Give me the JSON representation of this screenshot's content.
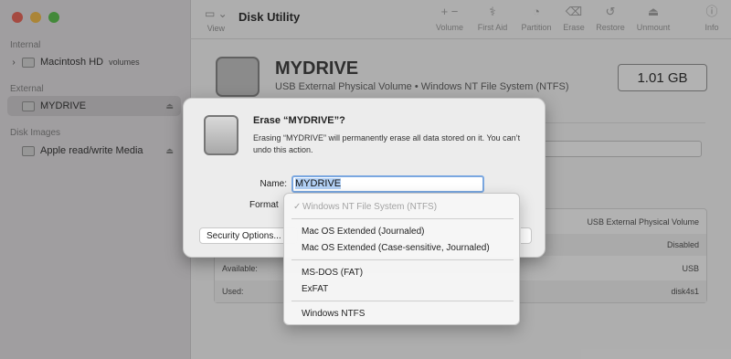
{
  "app": {
    "title": "Disk Utility"
  },
  "sidebar": {
    "sections": {
      "internal": "Internal",
      "external": "External",
      "disk_images": "Disk Images"
    },
    "items": [
      {
        "label": "Macintosh HD",
        "sub": "volumes"
      },
      {
        "label": "MYDRIVE"
      },
      {
        "label": "Apple read/write Media"
      }
    ]
  },
  "toolbar": {
    "view": "View",
    "volume": "Volume",
    "first_aid": "First Aid",
    "partition": "Partition",
    "erase": "Erase",
    "restore": "Restore",
    "unmount": "Unmount",
    "info": "Info",
    "volume_icon": "+ −"
  },
  "main": {
    "disk_name": "MYDRIVE",
    "disk_desc": "USB External Physical Volume • Windows NT File System (NTFS)",
    "size": "1.01 GB",
    "info_rows": [
      {
        "key": "",
        "value": "USB External Physical Volume"
      },
      {
        "key": "",
        "value": "Disabled"
      },
      {
        "key": "Available:",
        "value": "USB"
      },
      {
        "key": "Used:",
        "value": "disk4s1"
      }
    ]
  },
  "dialog": {
    "title": "Erase “MYDRIVE”?",
    "message": "Erasing “MYDRIVE” will permanently erase all data stored on it. You can’t undo this action.",
    "name_label": "Name:",
    "name_value": "MYDRIVE",
    "format_label": "Format",
    "security_button": "Security Options..."
  },
  "format_menu": {
    "selected": "Windows NT File System (NTFS)",
    "groups": [
      [
        "Mac OS Extended (Journaled)",
        "Mac OS Extended (Case-sensitive, Journaled)"
      ],
      [
        "MS-DOS (FAT)",
        "ExFAT"
      ],
      [
        "Windows NTFS"
      ]
    ]
  },
  "colors": {
    "close": "#ed6a5e",
    "minimize": "#f5bf4f",
    "zoom": "#61c554",
    "selection": "#b3d1f5",
    "focus_ring": "#7aa7e0"
  }
}
